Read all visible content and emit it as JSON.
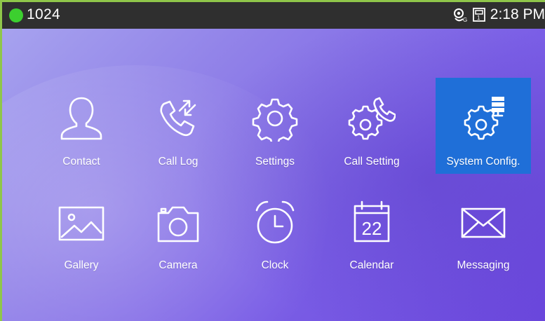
{
  "status_bar": {
    "account": "1024",
    "time": "2:18 PM",
    "indicator_color": "#3ccf2f",
    "icons": [
      "phone-gear-icon",
      "sim-card-icon"
    ]
  },
  "apps": [
    {
      "label": "Contact",
      "icon": "contact-icon",
      "selected": false
    },
    {
      "label": "Call Log",
      "icon": "call-log-icon",
      "selected": false
    },
    {
      "label": "Settings",
      "icon": "settings-gear-icon",
      "selected": false
    },
    {
      "label": "Call Setting",
      "icon": "call-setting-icon",
      "selected": false
    },
    {
      "label": "System Config.",
      "icon": "system-config-icon",
      "selected": true
    },
    {
      "label": "Gallery",
      "icon": "gallery-icon",
      "selected": false
    },
    {
      "label": "Camera",
      "icon": "camera-icon",
      "selected": false
    },
    {
      "label": "Clock",
      "icon": "alarm-clock-icon",
      "selected": false
    },
    {
      "label": "Calendar",
      "icon": "calendar-icon",
      "selected": false,
      "icon_text": "22"
    },
    {
      "label": "Messaging",
      "icon": "envelope-icon",
      "selected": false
    }
  ],
  "colors": {
    "selected_tile": "#1f6fd8",
    "status_bar": "#2f2f2f"
  }
}
